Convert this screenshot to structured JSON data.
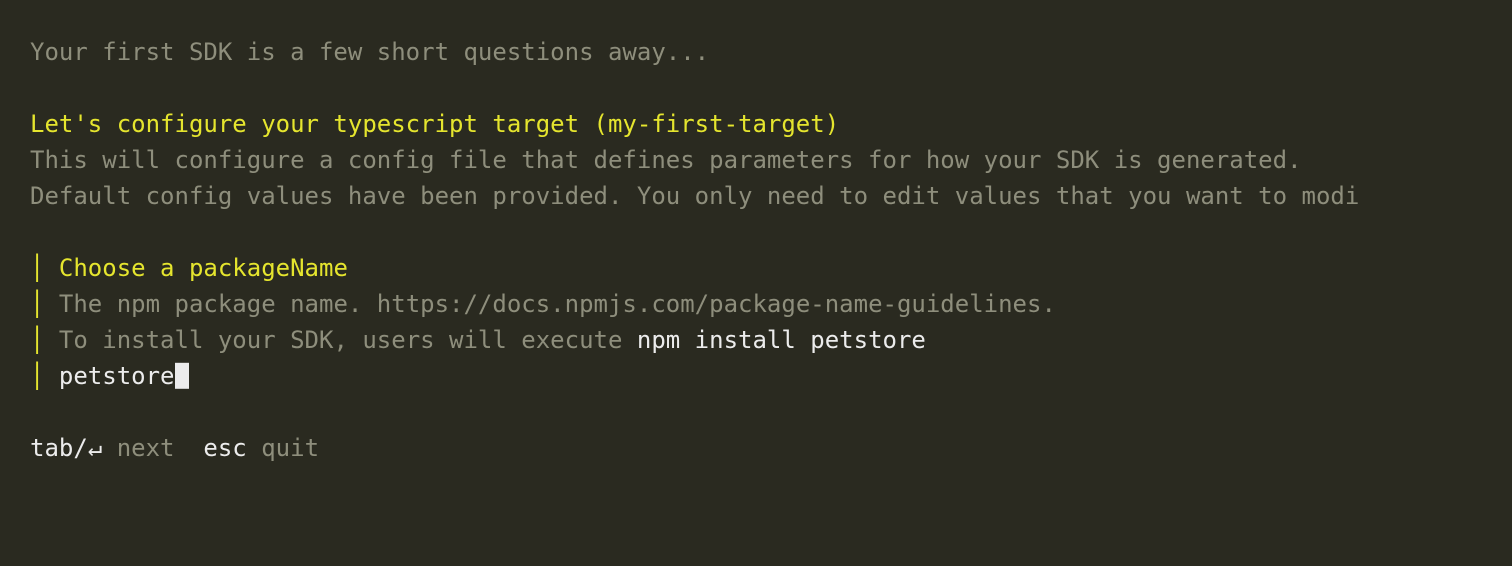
{
  "intro": "Your first SDK is a few short questions away...",
  "heading": "Let's configure your typescript target (my-first-target)",
  "desc1": "This will configure a config file that defines parameters for how your SDK is generated.",
  "desc2": "Default config values have been provided. You only need to edit values that you want to modi",
  "prompt": {
    "title": "Choose a packageName",
    "help": "The npm package name. https://docs.npmjs.com/package-name-guidelines.",
    "install_prefix": "To install your SDK, users will execute ",
    "install_cmd": "npm install petstore",
    "value": "petstore"
  },
  "footer": {
    "key1": "tab/↵",
    "label1": " next  ",
    "key2": "esc",
    "label2": " quit"
  },
  "bar": "│ "
}
